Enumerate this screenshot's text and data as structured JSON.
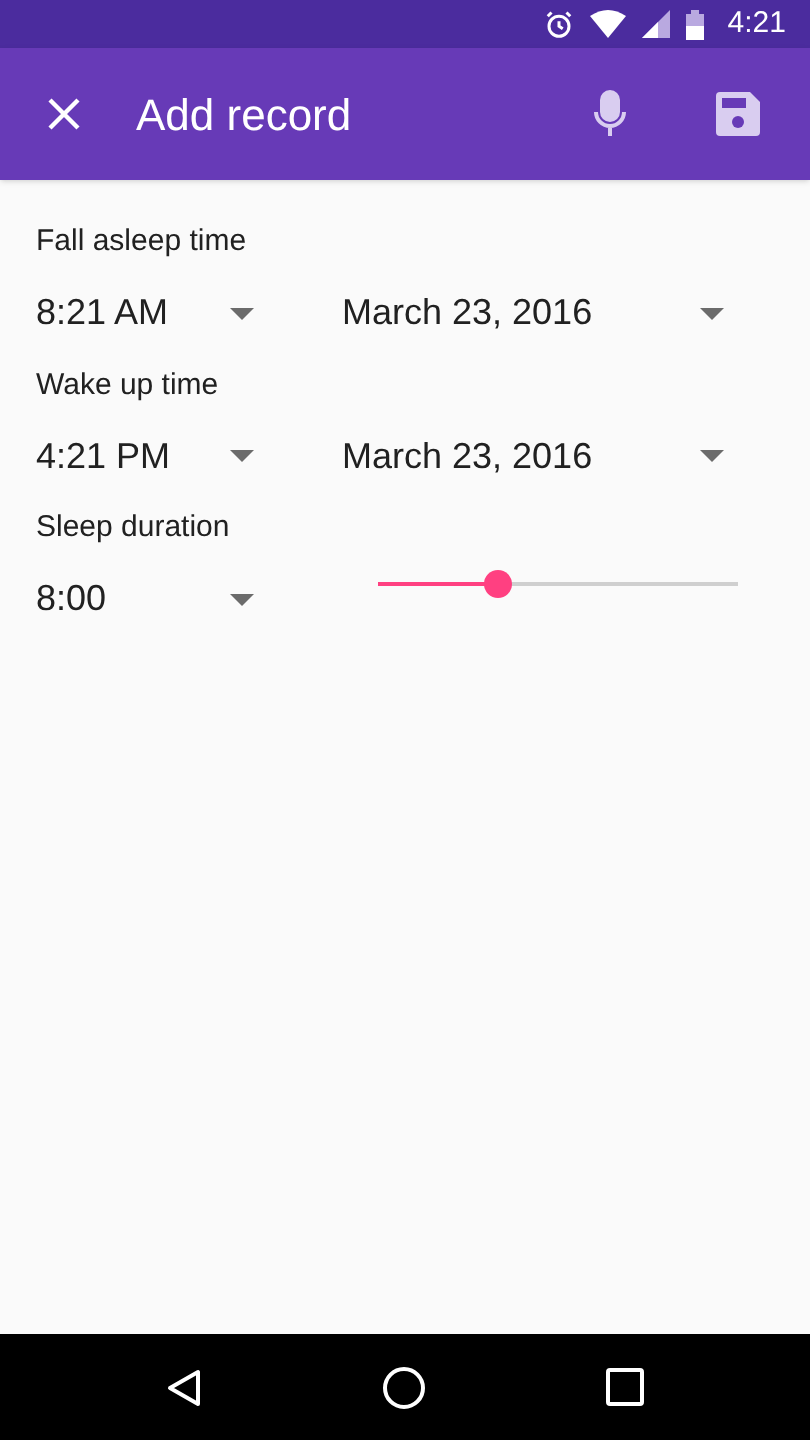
{
  "status_bar": {
    "time": "4:21"
  },
  "app_bar": {
    "title": "Add record"
  },
  "sections": [
    {
      "kind": "datetime",
      "label": "Fall asleep time",
      "time": "8:21 AM",
      "date": "March 23, 2016"
    },
    {
      "kind": "datetime",
      "label": "Wake up time",
      "time": "4:21 PM",
      "date": "March 23, 2016"
    },
    {
      "kind": "duration",
      "label": "Sleep duration",
      "value": "8:00",
      "level": 0.333
    }
  ]
}
